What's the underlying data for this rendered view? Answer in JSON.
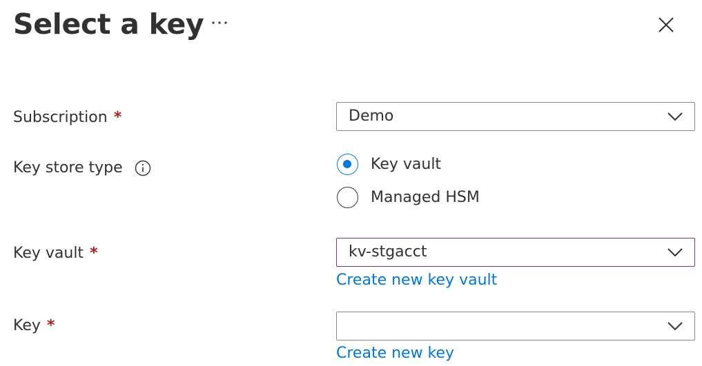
{
  "header": {
    "title": "Select a key",
    "more_icon": "more-horizontal-icon",
    "close_icon": "close-icon"
  },
  "form": {
    "subscription": {
      "label": "Subscription",
      "required_marker": "*",
      "value": "Demo"
    },
    "key_store_type": {
      "label": "Key store type",
      "info_icon": "info-icon",
      "options": [
        {
          "label": "Key vault",
          "selected": true
        },
        {
          "label": "Managed HSM",
          "selected": false
        }
      ]
    },
    "key_vault": {
      "label": "Key vault",
      "required_marker": "*",
      "value": "kv-stgacct",
      "create_link": "Create new key vault"
    },
    "key": {
      "label": "Key",
      "required_marker": "*",
      "value": "",
      "create_link": "Create new key"
    }
  },
  "colors": {
    "accent": "#0078d4",
    "required": "#a4262c",
    "focus_border": "#6b3a79",
    "text": "#323130",
    "border": "#8a8886"
  }
}
